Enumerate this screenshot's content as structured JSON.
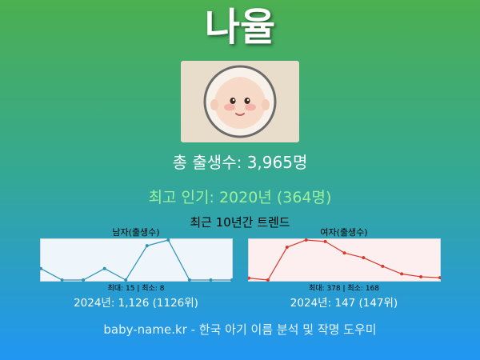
{
  "name": "나율",
  "total_births": "총 출생수: 3,965명",
  "peak_popularity": "최고 인기: 2020년 (364명)",
  "trend_title": "최근 10년간 트렌드",
  "male": {
    "label": "남자(출생수)",
    "minmax": "최대: 15 | 최소: 8",
    "rank_2024": "2024년: 1,126 (1126위)"
  },
  "female": {
    "label": "여자(출생수)",
    "minmax": "최대: 378 | 최소: 168",
    "rank_2024": "2024년: 147 (147위)"
  },
  "footer": "baby-name.kr - 한국 아기 이름 분석 및 작명 도우미",
  "colors": {
    "male_line": "#2a93b8",
    "female_line": "#d93a2b",
    "male_bg": "#eef6fc",
    "female_bg": "#fdeff0"
  },
  "chart_data": [
    {
      "type": "line",
      "title": "남자(출생수)",
      "series": [
        {
          "values": [
            10,
            8,
            8,
            10,
            8,
            14,
            15,
            8,
            8,
            8
          ]
        }
      ],
      "ylim": [
        8,
        15
      ]
    },
    {
      "type": "line",
      "title": "여자(출생수)",
      "series": [
        {
          "values": [
            178,
            168,
            340,
            378,
            370,
            310,
            285,
            240,
            200,
            185,
            180
          ]
        }
      ],
      "ylim": [
        168,
        378
      ]
    }
  ]
}
